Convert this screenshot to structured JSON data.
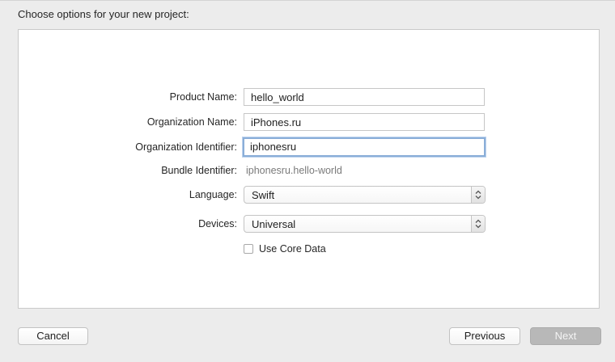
{
  "header": {
    "title": "Choose options for your new project:"
  },
  "form": {
    "product_name": {
      "label": "Product Name:",
      "value": "hello_world"
    },
    "organization_name": {
      "label": "Organization Name:",
      "value": "iPhones.ru"
    },
    "organization_identifier": {
      "label": "Organization Identifier:",
      "value": "iphonesru"
    },
    "bundle_identifier": {
      "label": "Bundle Identifier:",
      "value": "iphonesru.hello-world"
    },
    "language": {
      "label": "Language:",
      "selected": "Swift"
    },
    "devices": {
      "label": "Devices:",
      "selected": "Universal"
    },
    "use_core_data": {
      "label": "Use Core Data",
      "checked": false
    }
  },
  "footer": {
    "cancel_label": "Cancel",
    "previous_label": "Previous",
    "next_label": "Next"
  },
  "icons": {
    "select_arrows": "updown-chevron-icon"
  }
}
